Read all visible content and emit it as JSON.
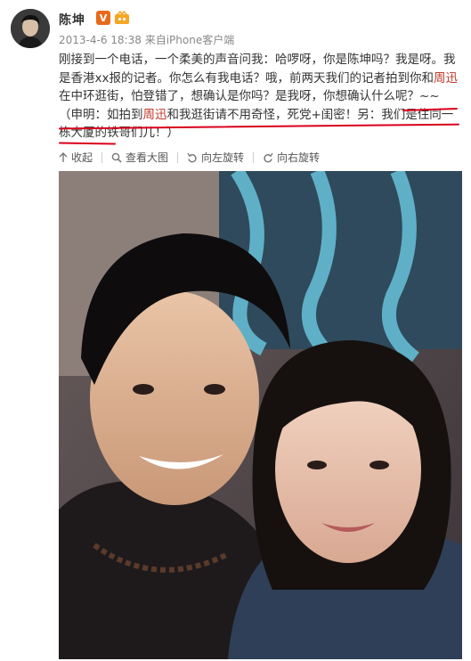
{
  "user": {
    "name": "陈坤",
    "verified_badge": "V"
  },
  "post_meta": {
    "datetime": "2013-4-6 18:38",
    "source_prefix": "来自",
    "source_client": "iPhone客户端"
  },
  "post_text": {
    "part1": "刚接到一个电话，一个柔美的声音问我：哈啰呀，你是陈坤吗？我是呀。我是香港xx报的记者。你怎么有我电话？哦，前两天我们的记者拍到你和",
    "link1": "周迅",
    "part2": "在中环逛街，怕登错了，想确认是你吗？是我呀，你想确认什么呢？~~（申明：如拍到",
    "link2": "周迅",
    "part3": "和我逛街请不用奇怪，死党+闺密！另：我们是住同一栋大厦的铁哥们儿！）"
  },
  "actions": {
    "collapse": "收起",
    "view_large": "查看大图",
    "rotate_left": "向左旋转",
    "rotate_right": "向右旋转"
  },
  "colors": {
    "link": "#c0392b",
    "annotation": "#d9001b",
    "verified": "#e76a1a"
  }
}
